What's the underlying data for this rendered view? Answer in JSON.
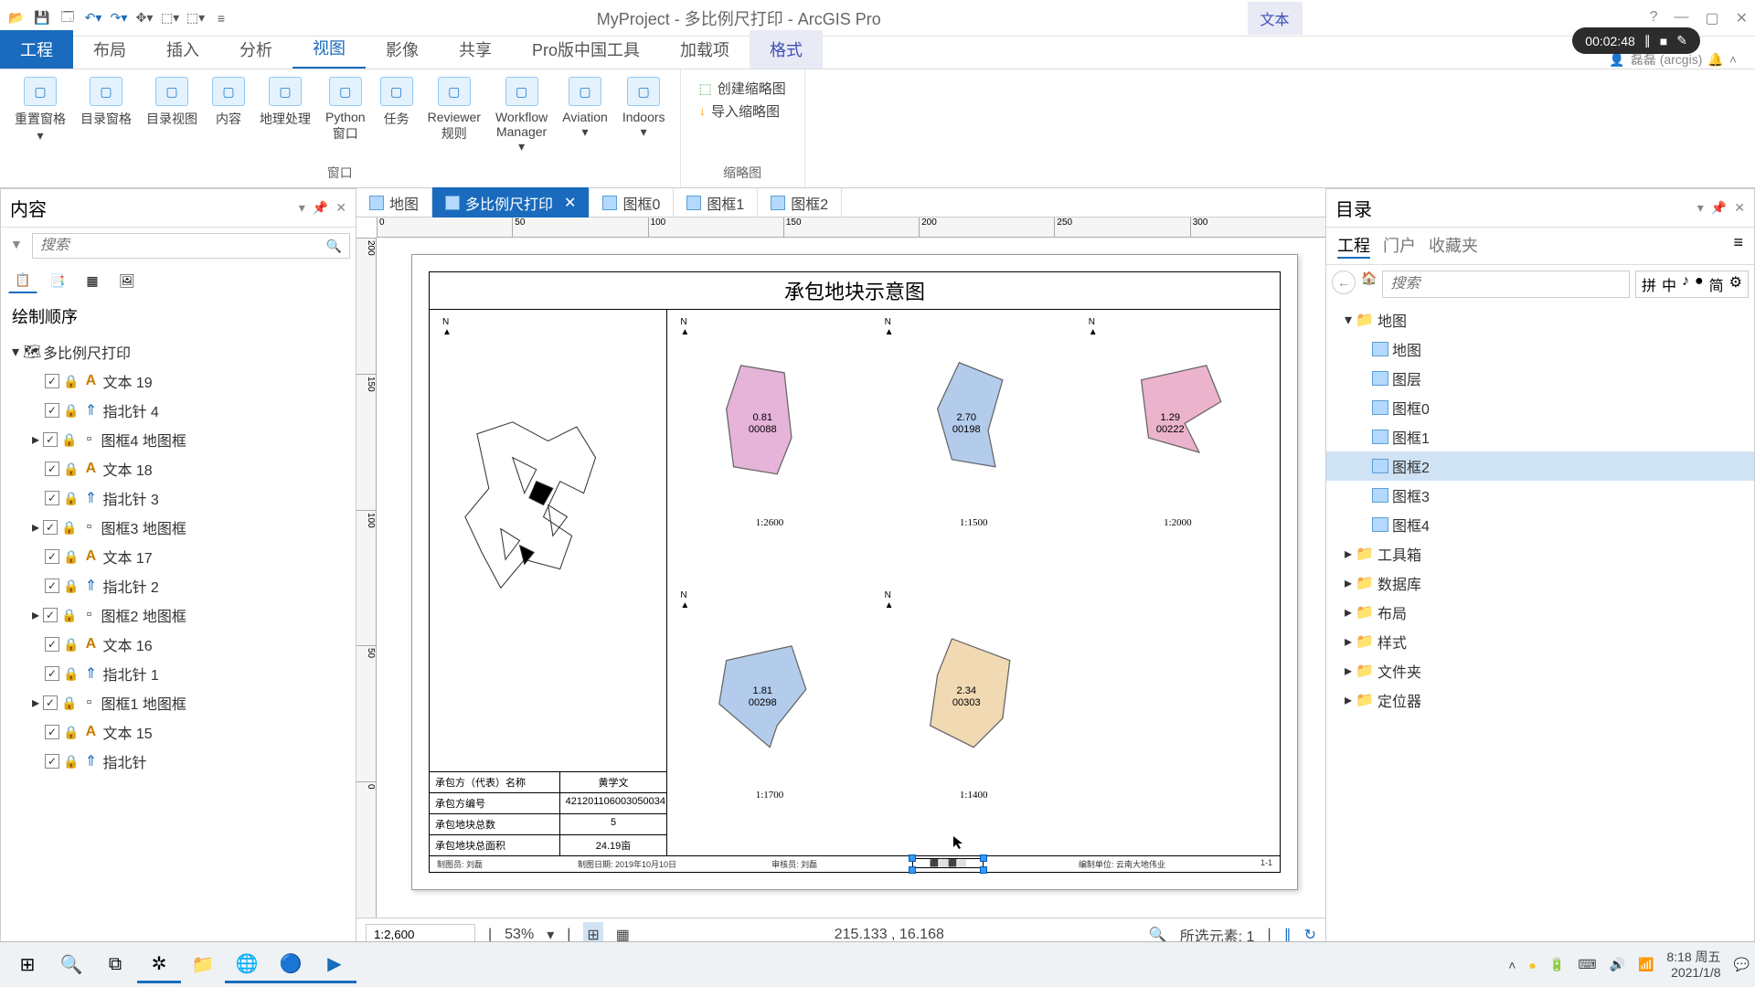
{
  "app": {
    "title": "MyProject - 多比例尺打印 - ArcGIS Pro",
    "context_tab_group": "文本",
    "context_tab": "格式",
    "user": "磊磊 (arcgis)"
  },
  "recorder": {
    "time": "00:02:48"
  },
  "ribbon_tabs": [
    "工程",
    "布局",
    "插入",
    "分析",
    "视图",
    "影像",
    "共享",
    "Pro版中国工具",
    "加载项"
  ],
  "ribbon": {
    "items": [
      {
        "label": "重置窗格",
        "drop": true
      },
      {
        "label": "目录窗格"
      },
      {
        "label": "目录视图"
      },
      {
        "label": "内容"
      },
      {
        "label": "地理处理"
      },
      {
        "label": "Python\n窗口"
      },
      {
        "label": "任务"
      },
      {
        "label": "Reviewer\n规则"
      },
      {
        "label": "Workflow\nManager",
        "drop": true
      },
      {
        "label": "Aviation",
        "drop": true
      },
      {
        "label": "Indoors",
        "drop": true
      }
    ],
    "group1_label": "窗口",
    "small_items": [
      "创建缩略图",
      "导入缩略图"
    ],
    "group2_label": "缩略图"
  },
  "contents": {
    "title": "内容",
    "search_placeholder": "搜索",
    "section": "绘制顺序",
    "root": "多比例尺打印",
    "items": [
      {
        "label": "文本 19",
        "icon": "A"
      },
      {
        "label": "指北针 4",
        "icon": "N"
      },
      {
        "label": "图框4 地图框",
        "icon": "F",
        "exp": true
      },
      {
        "label": "文本 18",
        "icon": "A"
      },
      {
        "label": "指北针 3",
        "icon": "N"
      },
      {
        "label": "图框3 地图框",
        "icon": "F",
        "exp": true
      },
      {
        "label": "文本 17",
        "icon": "A"
      },
      {
        "label": "指北针 2",
        "icon": "N"
      },
      {
        "label": "图框2 地图框",
        "icon": "F",
        "exp": true
      },
      {
        "label": "文本 16",
        "icon": "A"
      },
      {
        "label": "指北针 1",
        "icon": "N"
      },
      {
        "label": "图框1 地图框",
        "icon": "F",
        "exp": true
      },
      {
        "label": "文本 15",
        "icon": "A"
      },
      {
        "label": "指北针",
        "icon": "N"
      }
    ]
  },
  "view_tabs": [
    {
      "label": "地图"
    },
    {
      "label": "多比例尺打印",
      "active": true,
      "closable": true
    },
    {
      "label": "图框0"
    },
    {
      "label": "图框1"
    },
    {
      "label": "图框2"
    }
  ],
  "ruler_h": [
    "0",
    "50",
    "100",
    "150",
    "200",
    "250",
    "300"
  ],
  "ruler_v": [
    "200",
    "150",
    "100",
    "50",
    "0"
  ],
  "layout": {
    "title": "承包地块示意图",
    "info_rows": [
      {
        "k": "承包方（代表）名称",
        "v": "黄学文"
      },
      {
        "k": "承包方编号",
        "v": "421201106003050034"
      },
      {
        "k": "承包地块总数",
        "v": "5"
      },
      {
        "k": "承包地块总面积",
        "v": "24.19亩"
      }
    ],
    "frames": [
      {
        "scale": "1:2600",
        "fill": "#e6b3d9",
        "code": "0.81\n00088"
      },
      {
        "scale": "1:1500",
        "fill": "#b3ccec",
        "code": "2.70\n00198"
      },
      {
        "scale": "1:2000",
        "fill": "#ecb3cc",
        "code": "1.29\n00222"
      },
      {
        "scale": "1:1700",
        "fill": "#b3ccec",
        "code": "1.81\n00298",
        "row": 2
      },
      {
        "scale": "1:1400",
        "fill": "#f0d9b3",
        "code": "2.34\n00303",
        "row": 2
      }
    ],
    "footer": {
      "l": "制图员: 刘磊",
      "m": "制图日期: 2019年10月10日",
      "c": "审核员: 刘磊",
      "r": "编制单位: 云南大地伟业",
      "pg": "1-1"
    }
  },
  "status": {
    "scale": "1:2,600",
    "zoom": "53%",
    "coords": "215.133 , 16.168",
    "selection": "所选元素: 1"
  },
  "catalog": {
    "title": "目录",
    "tabs": [
      "工程",
      "门户",
      "收藏夹"
    ],
    "search_placeholder": "搜索",
    "ime": [
      "拼",
      "中",
      "♪",
      "●",
      "简",
      "⚙"
    ],
    "map_group": "地图",
    "maps": [
      "地图",
      "图层",
      "图框0",
      "图框1",
      "图框2",
      "图框3",
      "图框4"
    ],
    "selected_map": "图框2",
    "folders": [
      "工具箱",
      "数据库",
      "布局",
      "样式",
      "文件夹",
      "定位器"
    ]
  },
  "taskbar": {
    "time": "8:18 周五",
    "date": "2021/1/8"
  }
}
